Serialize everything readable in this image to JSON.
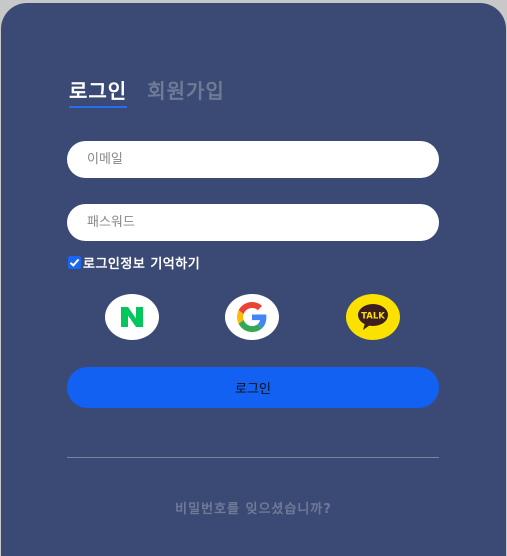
{
  "tabs": {
    "login": "로그인",
    "signup": "회원가입"
  },
  "form": {
    "email_placeholder": "이메일",
    "password_placeholder": "패스워드",
    "remember_label": "로그인정보 기억하기",
    "remember_checked": true
  },
  "social": {
    "naver_icon": "naver-n-icon",
    "google_icon": "google-g-icon",
    "kakao_icon": "kakao-talk-icon",
    "kakao_label": "TALK"
  },
  "actions": {
    "login_button": "로그인",
    "forgot_password": "비밀번호를 잊으셨습니까?"
  },
  "colors": {
    "background": "#3b4a74",
    "accent": "#1261f2",
    "naver_green": "#03c75a",
    "kakao_yellow": "#fae100"
  }
}
